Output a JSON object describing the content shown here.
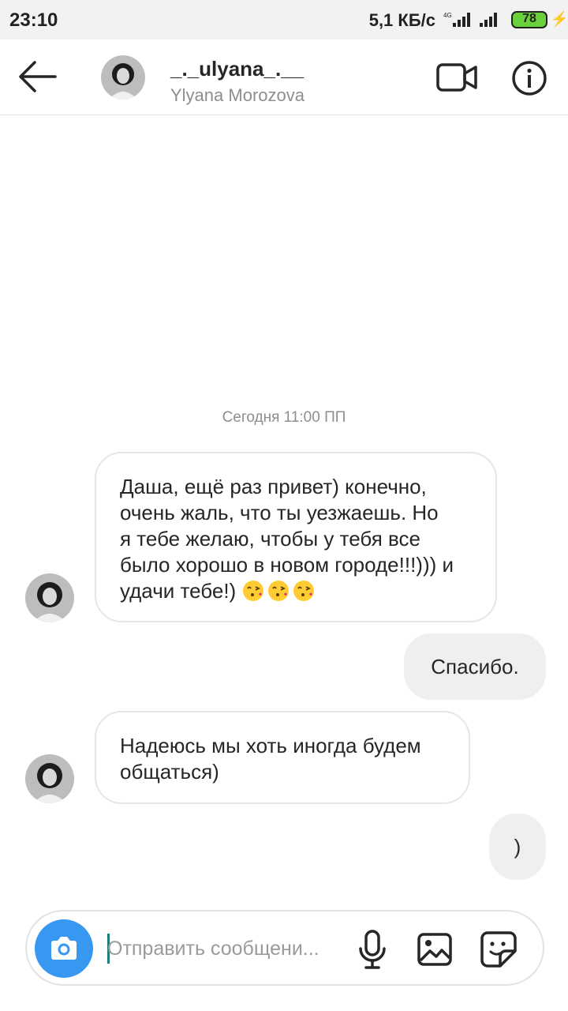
{
  "status_bar": {
    "time": "23:10",
    "speed": "5,1 КБ/с",
    "network": "4G",
    "battery": "78",
    "battery_color": "#6bd13a"
  },
  "header": {
    "back_icon": "arrow-left-icon",
    "username": "_._ulyana_.__",
    "full_name": "Ylyana Morozova",
    "video_icon": "video-camera-icon",
    "info_icon": "info-icon"
  },
  "chat": {
    "date_separator": "Сегодня 11:00 ПП",
    "messages": [
      {
        "sender": "them",
        "lines": [
          "Даша, ещё раз привет) конечно,",
          "очень жаль, что ты уезжаешь. Но",
          "я тебе желаю, чтобы у тебя все",
          "было хорошо в новом городе!!!))) и",
          "удачи тебе!) "
        ],
        "emoji": "kissing-face-emoji"
      },
      {
        "sender": "me",
        "text": "Спасибо."
      },
      {
        "sender": "them",
        "lines": [
          "Надеюсь мы хоть иногда будем",
          "общаться)"
        ]
      },
      {
        "sender": "me",
        "text": ")"
      }
    ]
  },
  "composer": {
    "placeholder": "Отправить сообщени...",
    "camera_icon": "camera-icon",
    "mic_icon": "microphone-icon",
    "gallery_icon": "image-gallery-icon",
    "sticker_icon": "sticker-icon",
    "accent": "#3897f0"
  }
}
